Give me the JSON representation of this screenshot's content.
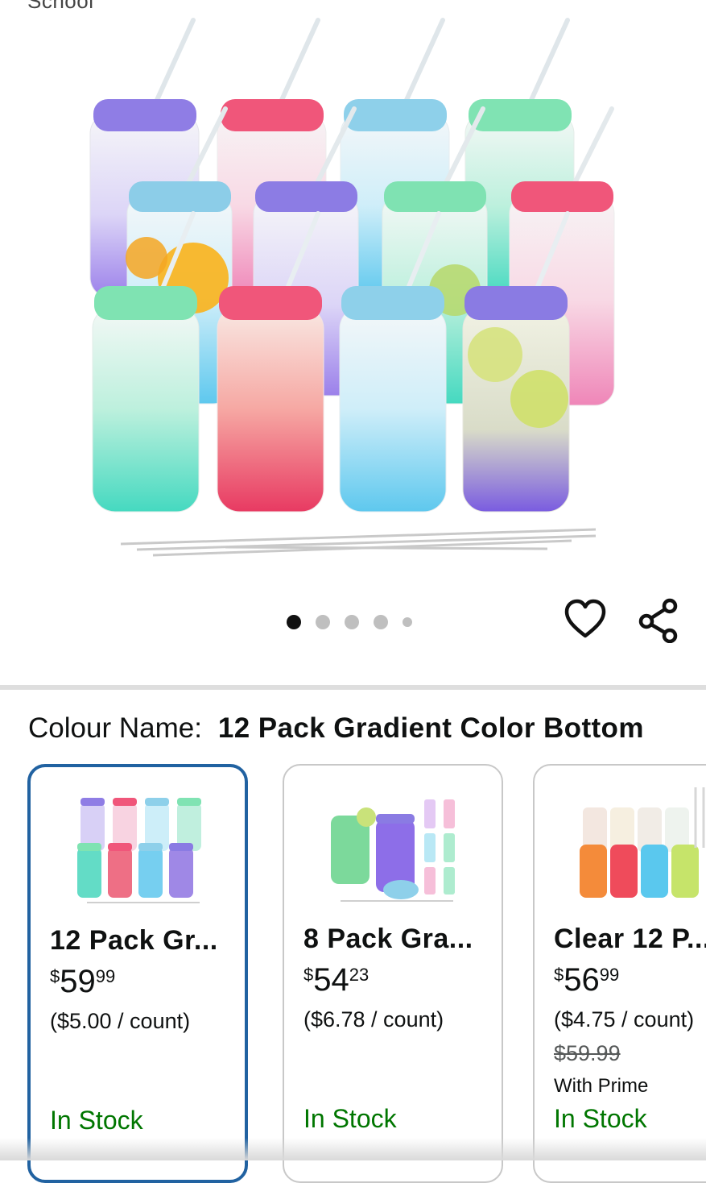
{
  "top_cut_text": "School",
  "carousel": {
    "dots": 5,
    "active_index": 0
  },
  "actions": {
    "wishlist_icon": "heart-icon",
    "share_icon": "share-icon"
  },
  "colour": {
    "label": "Colour Name:",
    "value": "12 Pack Gradient Color Bottom"
  },
  "options": [
    {
      "title": "12 Pack Gr...",
      "price_currency": "$",
      "price_whole": "59",
      "price_fraction": "99",
      "unit_price": "($5.00 / count)",
      "list_price": "",
      "prime_note": "",
      "stock": "In Stock",
      "selected": true
    },
    {
      "title": "8 Pack Gra...",
      "price_currency": "$",
      "price_whole": "54",
      "price_fraction": "23",
      "unit_price": "($6.78 / count)",
      "list_price": "",
      "prime_note": "",
      "stock": "In Stock",
      "selected": false
    },
    {
      "title": "Clear 12 P...",
      "price_currency": "$",
      "price_whole": "56",
      "price_fraction": "99",
      "unit_price": "($4.75 / count)",
      "list_price": "$59.99",
      "prime_note": "With Prime",
      "stock": "In Stock",
      "selected": false
    }
  ],
  "colors": {
    "selected_border": "#2162a1",
    "in_stock": "#007600",
    "purple_lid": "#8a7be3",
    "pink_lid": "#f2577a",
    "blue_lid": "#8ecfe9",
    "green_lid": "#7fe3b2"
  }
}
